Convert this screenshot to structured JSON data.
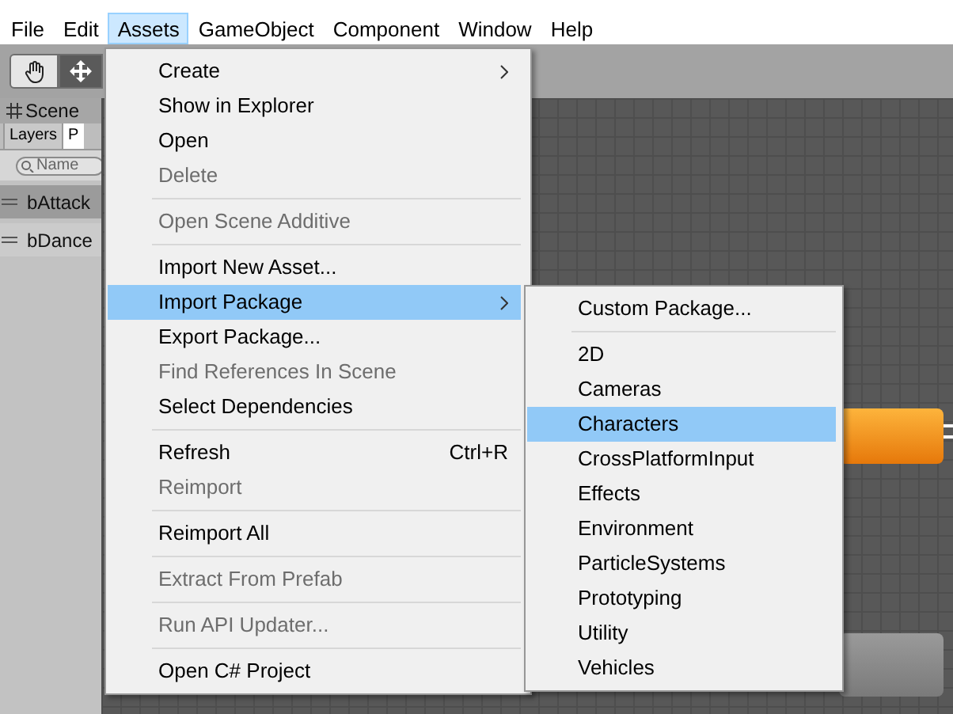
{
  "menubar": [
    {
      "label": "File",
      "selected": false
    },
    {
      "label": "Edit",
      "selected": false
    },
    {
      "label": "Assets",
      "selected": true
    },
    {
      "label": "GameObject",
      "selected": false
    },
    {
      "label": "Component",
      "selected": false
    },
    {
      "label": "Window",
      "selected": false
    },
    {
      "label": "Help",
      "selected": false
    }
  ],
  "left_panel": {
    "tab": "Scene",
    "subtabs": [
      {
        "label": "Layers",
        "selected": false
      },
      {
        "label": "P",
        "selected": true
      }
    ],
    "search": {
      "placeholder": "Name"
    },
    "parameters": [
      {
        "name": "bAttack",
        "selected": true
      },
      {
        "name": "bDance",
        "selected": false
      }
    ]
  },
  "assets_menu": [
    {
      "kind": "item",
      "label": "Create",
      "disabled": false,
      "submenu": true,
      "selected": false
    },
    {
      "kind": "item",
      "label": "Show in Explorer",
      "disabled": false,
      "submenu": false,
      "selected": false
    },
    {
      "kind": "item",
      "label": "Open",
      "disabled": false,
      "submenu": false,
      "selected": false
    },
    {
      "kind": "item",
      "label": "Delete",
      "disabled": true,
      "submenu": false,
      "selected": false
    },
    {
      "kind": "separator"
    },
    {
      "kind": "item",
      "label": "Open Scene Additive",
      "disabled": true,
      "submenu": false,
      "selected": false
    },
    {
      "kind": "separator"
    },
    {
      "kind": "item",
      "label": "Import New Asset...",
      "disabled": false,
      "submenu": false,
      "selected": false
    },
    {
      "kind": "item",
      "label": "Import Package",
      "disabled": false,
      "submenu": true,
      "selected": true
    },
    {
      "kind": "item",
      "label": "Export Package...",
      "disabled": false,
      "submenu": false,
      "selected": false
    },
    {
      "kind": "item",
      "label": "Find References In Scene",
      "disabled": true,
      "submenu": false,
      "selected": false
    },
    {
      "kind": "item",
      "label": "Select Dependencies",
      "disabled": false,
      "submenu": false,
      "selected": false
    },
    {
      "kind": "separator"
    },
    {
      "kind": "item",
      "label": "Refresh",
      "shortcut": "Ctrl+R",
      "disabled": false,
      "submenu": false,
      "selected": false
    },
    {
      "kind": "item",
      "label": "Reimport",
      "disabled": true,
      "submenu": false,
      "selected": false
    },
    {
      "kind": "separator"
    },
    {
      "kind": "item",
      "label": "Reimport All",
      "disabled": false,
      "submenu": false,
      "selected": false
    },
    {
      "kind": "separator"
    },
    {
      "kind": "item",
      "label": "Extract From Prefab",
      "disabled": true,
      "submenu": false,
      "selected": false
    },
    {
      "kind": "separator"
    },
    {
      "kind": "item",
      "label": "Run API Updater...",
      "disabled": true,
      "submenu": false,
      "selected": false
    },
    {
      "kind": "separator"
    },
    {
      "kind": "item",
      "label": "Open C# Project",
      "disabled": false,
      "submenu": false,
      "selected": false
    }
  ],
  "import_package_submenu": [
    {
      "kind": "item",
      "label": "Custom Package...",
      "selected": false
    },
    {
      "kind": "separator"
    },
    {
      "kind": "item",
      "label": "2D",
      "selected": false
    },
    {
      "kind": "item",
      "label": "Cameras",
      "selected": false
    },
    {
      "kind": "item",
      "label": "Characters",
      "selected": true
    },
    {
      "kind": "item",
      "label": "CrossPlatformInput",
      "selected": false
    },
    {
      "kind": "item",
      "label": "Effects",
      "selected": false
    },
    {
      "kind": "item",
      "label": "Environment",
      "selected": false
    },
    {
      "kind": "item",
      "label": "ParticleSystems",
      "selected": false
    },
    {
      "kind": "item",
      "label": "Prototyping",
      "selected": false
    },
    {
      "kind": "item",
      "label": "Utility",
      "selected": false
    },
    {
      "kind": "item",
      "label": "Vehicles",
      "selected": false
    }
  ]
}
